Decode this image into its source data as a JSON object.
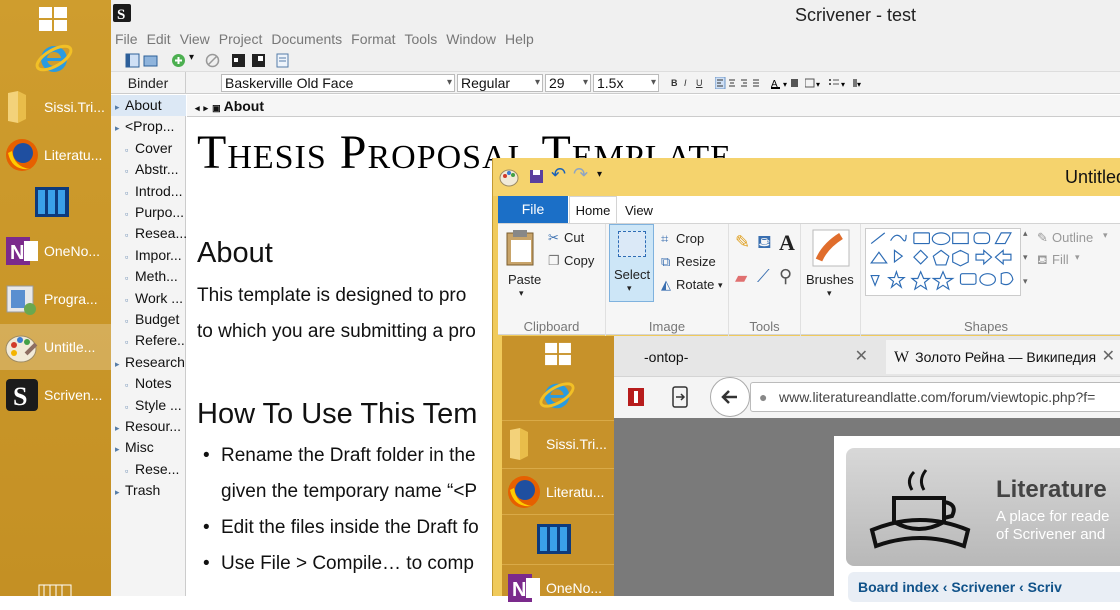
{
  "taskbar": {
    "items": [
      {
        "label": "Sissi.Tri...",
        "icon": "folder-icon"
      },
      {
        "label": "Literatu...",
        "icon": "firefox-icon"
      },
      {
        "label": "",
        "icon": "books-icon"
      },
      {
        "label": "OneNo...",
        "icon": "onenote-icon"
      },
      {
        "label": "Progra...",
        "icon": "programs-icon"
      },
      {
        "label": "Untitle...",
        "icon": "paint-icon"
      },
      {
        "label": "Scriven...",
        "icon": "scrivener-icon"
      }
    ]
  },
  "scrivener": {
    "title": "Scrivener - test",
    "menu": [
      "File",
      "Edit",
      "View",
      "Project",
      "Documents",
      "Format",
      "Tools",
      "Window",
      "Help"
    ],
    "format": {
      "binder_label": "Binder",
      "font": "Baskerville Old Face",
      "style": "Regular",
      "size": "29",
      "spacing": "1.5x",
      "bold": "B",
      "italic": "I",
      "underline": "U"
    },
    "binder": [
      {
        "label": "About",
        "indent": 0,
        "selected": true
      },
      {
        "label": "<Prop...",
        "indent": 0
      },
      {
        "label": "Cover",
        "indent": 1
      },
      {
        "label": "Abstr...",
        "indent": 1
      },
      {
        "label": "Introd...",
        "indent": 1
      },
      {
        "label": "Purpo...",
        "indent": 1
      },
      {
        "label": "Resea...",
        "indent": 1
      },
      {
        "label": "Impor...",
        "indent": 1
      },
      {
        "label": "Meth...",
        "indent": 1
      },
      {
        "label": "Work ...",
        "indent": 1
      },
      {
        "label": "Budget",
        "indent": 1
      },
      {
        "label": "Refere...",
        "indent": 1
      },
      {
        "label": "Research",
        "indent": 0
      },
      {
        "label": "Notes",
        "indent": 1
      },
      {
        "label": "Style ...",
        "indent": 1
      },
      {
        "label": "Resour...",
        "indent": 0
      },
      {
        "label": "Misc",
        "indent": 0
      },
      {
        "label": "Rese...",
        "indent": 1
      },
      {
        "label": "Trash",
        "indent": 0
      }
    ],
    "editor": {
      "header": "About",
      "doc_title": "Thesis Proposal Template",
      "h1": "About",
      "p1": "This template is designed to pro",
      "p2": "to which you are submitting a pro",
      "h2": "How To Use This Tem",
      "li1": "Rename the Draft folder in the",
      "li1b": "given the temporary name “<P",
      "li2": "Edit the files inside the Draft fo",
      "li3": "Use File > Compile… to comp"
    }
  },
  "paint": {
    "title": "Untitled",
    "tabs": {
      "file": "File",
      "home": "Home",
      "view": "View"
    },
    "clipboard": {
      "paste": "Paste",
      "cut": "Cut",
      "copy": "Copy",
      "label": "Clipboard"
    },
    "image": {
      "select": "Select",
      "crop": "Crop",
      "resize": "Resize",
      "rotate": "Rotate",
      "label": "Image"
    },
    "tools": {
      "label": "Tools"
    },
    "brushes": {
      "label": "Brushes"
    },
    "shapes": {
      "label": "Shapes",
      "outline": "Outline",
      "fill": "Fill"
    }
  },
  "nested_taskbar": {
    "items": [
      {
        "label": "Sissi.Tri...",
        "icon": "folder-icon"
      },
      {
        "label": "Literatu...",
        "icon": "firefox-icon"
      },
      {
        "label": "",
        "icon": "books-icon"
      },
      {
        "label": "OneNo...",
        "icon": "onenote-icon"
      }
    ]
  },
  "browser": {
    "tab1": "-ontop-",
    "tab2": "Золото Рейна — Википедия",
    "url": "www.literatureandlatte.com/forum/viewtopic.php?f=",
    "site_name": "Literature",
    "tagline1": "A place for reade",
    "tagline2": "of Scrivener and",
    "breadcrumb": "Board index ‹ Scrivener ‹ Scriv"
  }
}
